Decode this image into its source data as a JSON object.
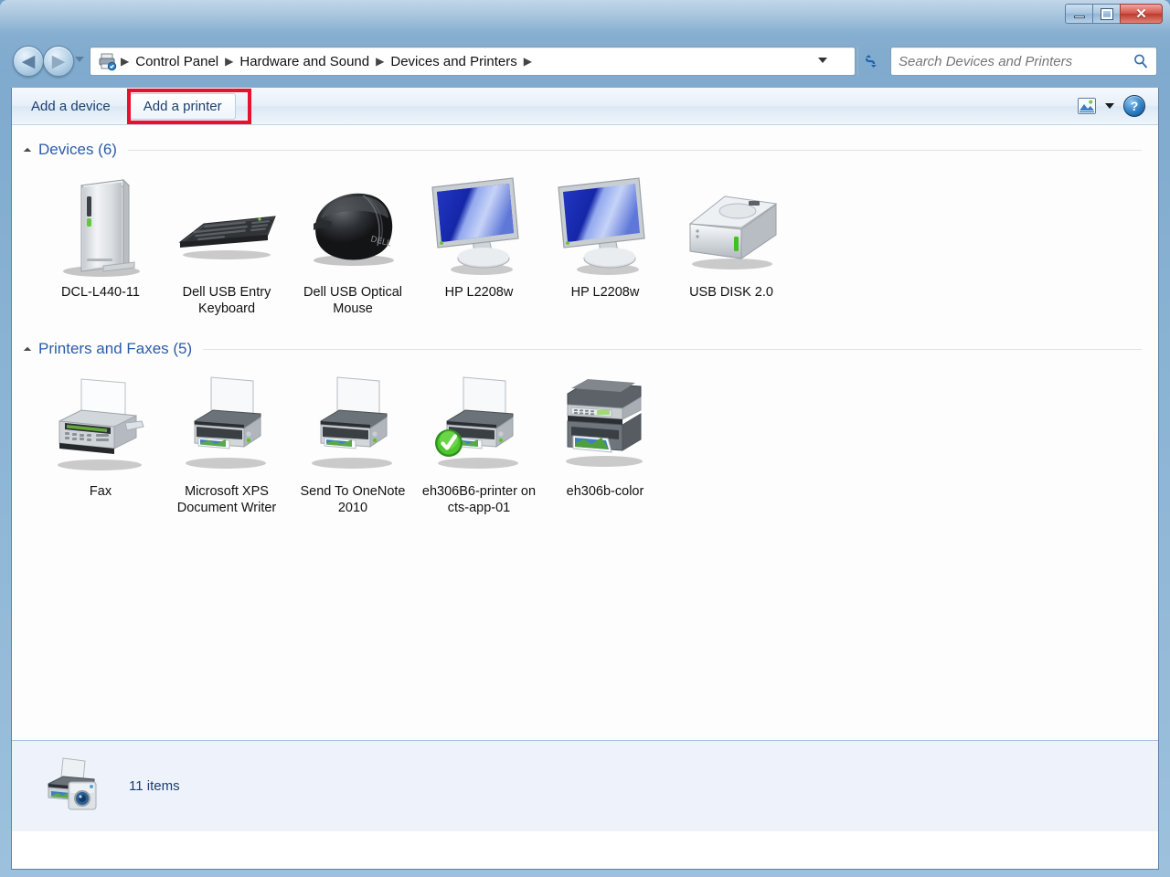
{
  "window": {
    "minimize_label": "Minimize",
    "maximize_label": "Maximize",
    "close_label": "Close",
    "close_glyph": "✕"
  },
  "nav": {
    "back_label": "Back",
    "back_glyph": "◀",
    "forward_label": "Forward",
    "forward_glyph": "▶",
    "recent_label": "Recent pages",
    "refresh_label": "Refresh"
  },
  "address": {
    "icon": "printer-icon",
    "separator": "▶",
    "crumbs": [
      {
        "label": "Control Panel"
      },
      {
        "label": "Hardware and Sound"
      },
      {
        "label": "Devices and Printers"
      }
    ]
  },
  "search": {
    "placeholder": "Search Devices and Printers",
    "value": "",
    "icon": "search-icon"
  },
  "toolbar": {
    "add_device_label": "Add a device",
    "add_printer_label": "Add a printer",
    "view_icon": "change-view-icon",
    "view_dropdown_label": "More options",
    "help_label": "Help",
    "help_glyph": "?",
    "highlight_color": "#e8112d"
  },
  "groups": [
    {
      "id": "devices",
      "header": "Devices (6)",
      "items": [
        {
          "label": "DCL-L440-11",
          "icon": "computer-tower-icon",
          "default": false
        },
        {
          "label": "Dell USB Entry Keyboard",
          "icon": "keyboard-icon",
          "default": false
        },
        {
          "label": "Dell USB Optical Mouse",
          "icon": "mouse-icon",
          "default": false
        },
        {
          "label": "HP L2208w",
          "icon": "monitor-icon",
          "default": false
        },
        {
          "label": "HP L2208w",
          "icon": "monitor-icon",
          "default": false
        },
        {
          "label": "USB DISK 2.0",
          "icon": "external-drive-icon",
          "default": false
        }
      ]
    },
    {
      "id": "printers",
      "header": "Printers and Faxes (5)",
      "items": [
        {
          "label": "Fax",
          "icon": "fax-machine-icon",
          "default": false
        },
        {
          "label": "Microsoft XPS Document Writer",
          "icon": "printer-icon",
          "default": false
        },
        {
          "label": "Send To OneNote 2010",
          "icon": "printer-icon",
          "default": false
        },
        {
          "label": "eh306B6-printer on cts-app-01",
          "icon": "printer-icon",
          "default": true
        },
        {
          "label": "eh306b-color",
          "icon": "multifunction-printer-icon",
          "default": false
        }
      ]
    }
  ],
  "status": {
    "icon": "printer-camera-icon",
    "text": "11 items"
  }
}
